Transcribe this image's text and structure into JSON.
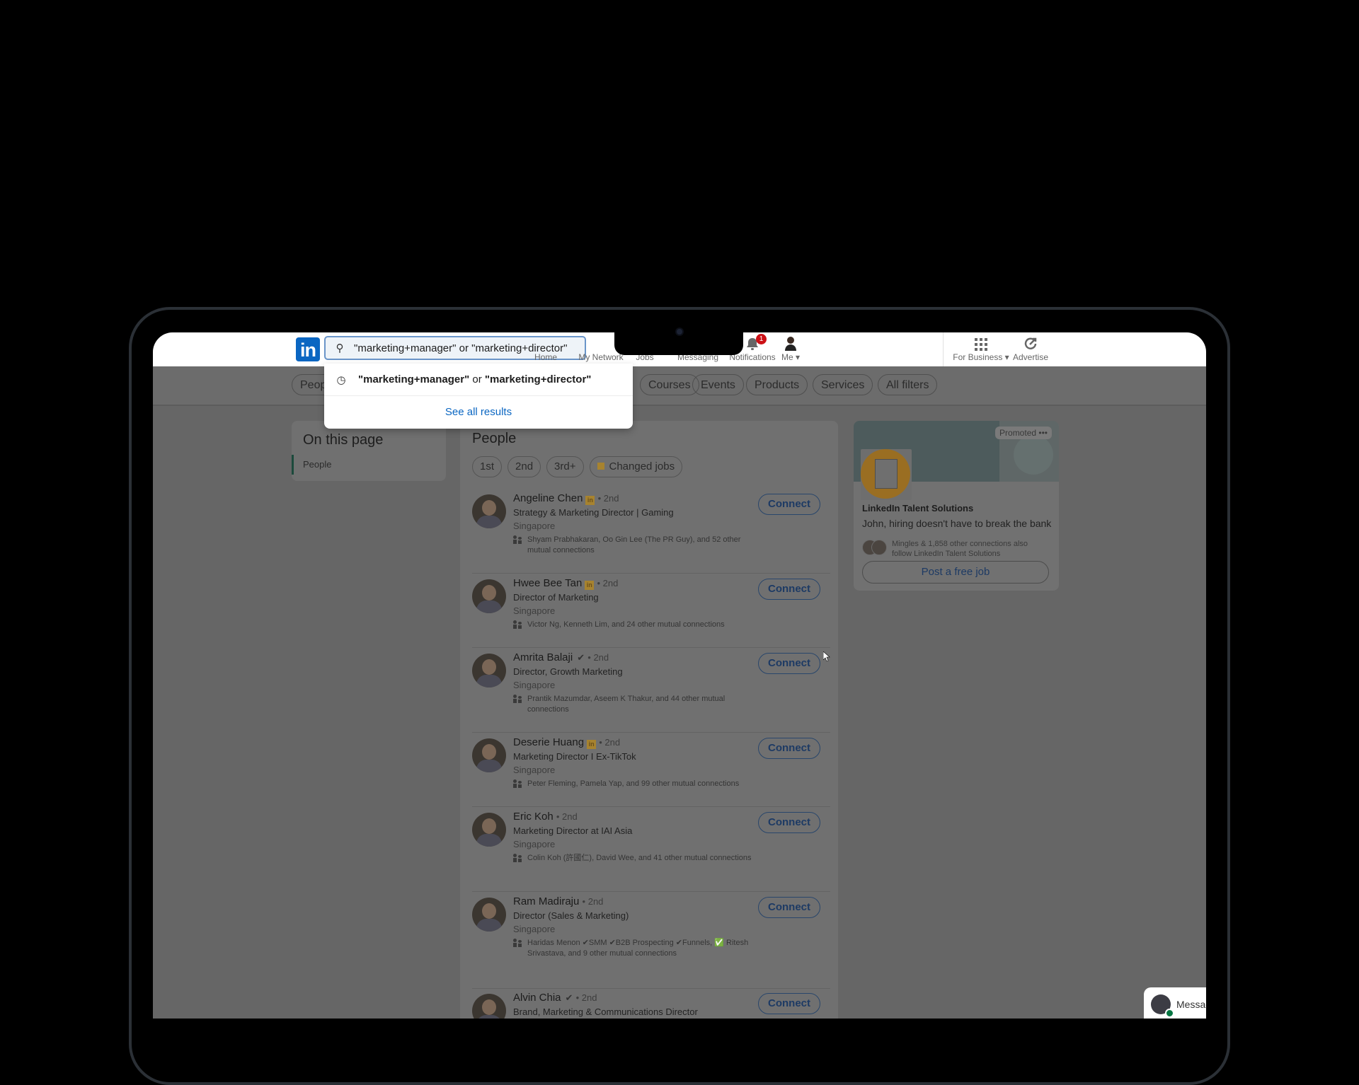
{
  "app": "LinkedIn",
  "navbar": {
    "search_value": "\"marketing+manager\" or \"marketing+director\"",
    "search_icon": "search-icon",
    "items": [
      {
        "label": "Home",
        "icon": "home-icon"
      },
      {
        "label": "My Network",
        "icon": "network-icon"
      },
      {
        "label": "Jobs",
        "icon": "briefcase-icon"
      },
      {
        "label": "Messaging",
        "icon": "message-icon"
      },
      {
        "label": "Notifications",
        "icon": "bell-icon",
        "badge": "1"
      },
      {
        "label": "Me ▾",
        "icon": "avatar"
      },
      {
        "label": "For Business ▾",
        "icon": "grid-icon"
      },
      {
        "label": "Advertise",
        "icon": "advertise-icon"
      }
    ]
  },
  "dropdown": {
    "recent_query_part1": "\"marketing+manager\"",
    "recent_query_or": " or ",
    "recent_query_part2": "\"marketing+director\"",
    "see_all": "See all results"
  },
  "filters": {
    "partial_first": "Peop",
    "pills": [
      "Courses",
      "Events",
      "Products",
      "Services",
      "All filters"
    ]
  },
  "left_panel": {
    "title": "On this page",
    "link": "People"
  },
  "people_section": {
    "title": "People",
    "chips": [
      "1st",
      "2nd",
      "3rd+",
      "Changed jobs"
    ],
    "connect_label": "Connect",
    "results": [
      {
        "name": "Angeline Chen",
        "badge": "linkedin-premium",
        "degree": "• 2nd",
        "title": "Strategy & Marketing Director | Gaming",
        "location": "Singapore",
        "mutual": "Shyam Prabhakaran, Oo Gin Lee (The PR Guy), and 52 other mutual connections"
      },
      {
        "name": "Hwee Bee Tan",
        "badge": "linkedin-premium",
        "degree": "• 2nd",
        "title": "Director of Marketing",
        "location": "Singapore",
        "mutual": "Victor Ng, Kenneth Lim, and 24 other mutual connections"
      },
      {
        "name": "Amrita Balaji",
        "badge": "verified",
        "degree": "• 2nd",
        "title": "Director, Growth Marketing",
        "location": "Singapore",
        "mutual": "Prantik Mazumdar, Aseem K Thakur, and 44 other mutual connections"
      },
      {
        "name": "Deserie Huang",
        "badge": "linkedin-premium",
        "degree": "• 2nd",
        "title": "Marketing Director I Ex-TikTok",
        "location": "Singapore",
        "mutual": "Peter Fleming, Pamela Yap, and 99 other mutual connections"
      },
      {
        "name": "Eric Koh",
        "badge": "",
        "degree": "• 2nd",
        "title": "Marketing Director at IAI Asia",
        "location": "Singapore",
        "mutual": "Colin Koh (許國仁), David Wee, and 41 other mutual connections"
      },
      {
        "name": "Ram Madiraju",
        "badge": "",
        "degree": "• 2nd",
        "title": "Director (Sales & Marketing)",
        "location": "Singapore",
        "mutual": "Haridas Menon ✔SMM ✔B2B Prospecting ✔Funnels, ✅ Ritesh Srivastava, and 9 other mutual connections"
      },
      {
        "name": "Alvin Chia",
        "badge": "verified",
        "degree": "• 2nd",
        "title": "Brand, Marketing & Communications Director",
        "location": "",
        "mutual": ""
      }
    ]
  },
  "ad": {
    "promoted": "Promoted",
    "more": "•••",
    "company": "LinkedIn Talent Solutions",
    "headline": "John, hiring doesn't have to break the bank",
    "follow_text": "Mingles & 1,858 other connections also follow LinkedIn Talent Solutions",
    "cta": "Post a free job"
  },
  "messaging_tab": {
    "label": "Messag"
  }
}
